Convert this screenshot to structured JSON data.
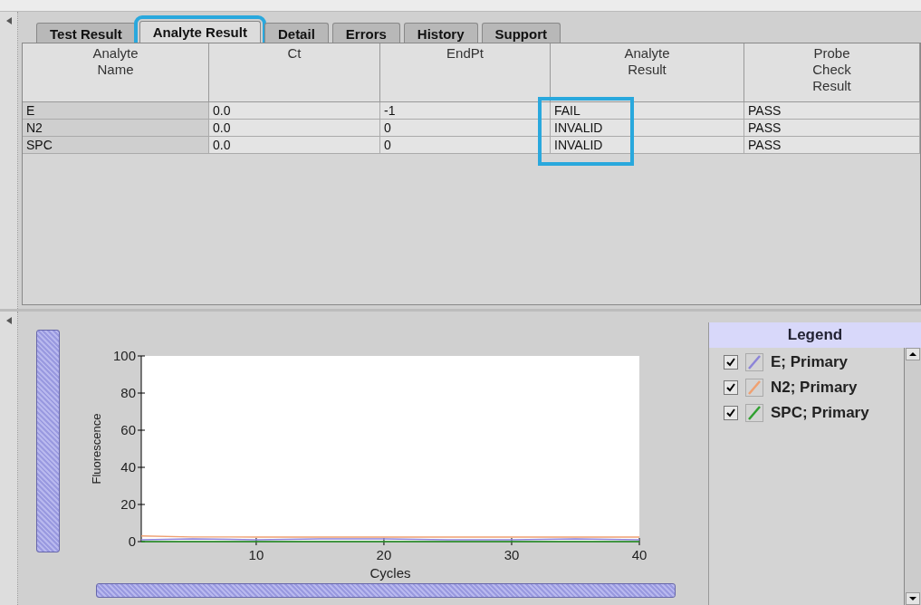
{
  "tabs": [
    {
      "label": "Test Result",
      "selected": false,
      "highlighted": false
    },
    {
      "label": "Analyte Result",
      "selected": true,
      "highlighted": true
    },
    {
      "label": "Detail",
      "selected": false,
      "highlighted": false
    },
    {
      "label": "Errors",
      "selected": false,
      "highlighted": false
    },
    {
      "label": "History",
      "selected": false,
      "highlighted": false
    },
    {
      "label": "Support",
      "selected": false,
      "highlighted": false
    }
  ],
  "table": {
    "columns": [
      {
        "label": "Analyte\nName",
        "highlighted": false
      },
      {
        "label": "Ct",
        "highlighted": false
      },
      {
        "label": "EndPt",
        "highlighted": false
      },
      {
        "label": "Analyte\nResult",
        "highlighted": true
      },
      {
        "label": "Probe\nCheck\nResult",
        "highlighted": false
      }
    ],
    "rows": [
      [
        "E",
        "0.0",
        "-1",
        "FAIL",
        "PASS"
      ],
      [
        "N2",
        "0.0",
        "0",
        "INVALID",
        "PASS"
      ],
      [
        "SPC",
        "0.0",
        "0",
        "INVALID",
        "PASS"
      ]
    ]
  },
  "chart_data": {
    "type": "line",
    "xlabel": "Cycles",
    "ylabel": "Fluorescence",
    "x": [
      1,
      5,
      10,
      15,
      20,
      25,
      30,
      35,
      40
    ],
    "xlim": [
      1,
      40
    ],
    "ylim": [
      0,
      100
    ],
    "xticks": [
      10,
      20,
      30,
      40
    ],
    "yticks": [
      0,
      20,
      40,
      60,
      80,
      100
    ],
    "series": [
      {
        "name": "E; Primary",
        "color": "#8c84d8",
        "values": [
          1,
          1.5,
          1,
          1.5,
          1.5,
          1,
          1,
          1.5,
          1
        ]
      },
      {
        "name": "N2; Primary",
        "color": "#f0a070",
        "values": [
          3,
          2.5,
          2.5,
          2.5,
          2.5,
          2.5,
          2.5,
          2.5,
          2.5
        ]
      },
      {
        "name": "SPC; Primary",
        "color": "#30a030",
        "values": [
          0,
          0,
          0,
          0,
          0,
          0,
          0,
          0,
          0
        ]
      }
    ]
  },
  "legend": {
    "title": "Legend",
    "items": [
      {
        "checked": true
      },
      {
        "checked": true
      },
      {
        "checked": true
      }
    ]
  }
}
